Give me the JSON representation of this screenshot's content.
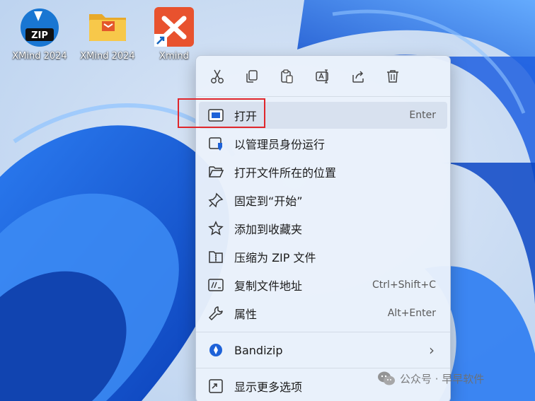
{
  "desktop_icons": [
    {
      "label": "XMind 2024",
      "icon": "zip-archive-icon"
    },
    {
      "label": "XMind 2024",
      "icon": "folder-icon"
    },
    {
      "label": "Xmind",
      "icon": "xmind-shortcut-icon"
    }
  ],
  "context_menu": {
    "toolbar": [
      {
        "name": "cut",
        "icon": "scissors-icon"
      },
      {
        "name": "copy",
        "icon": "copy-icon"
      },
      {
        "name": "paste",
        "icon": "paste-icon"
      },
      {
        "name": "rename",
        "icon": "rename-icon"
      },
      {
        "name": "share",
        "icon": "share-icon"
      },
      {
        "name": "delete",
        "icon": "trash-icon"
      }
    ],
    "items": [
      {
        "label": "打开",
        "shortcut": "Enter",
        "icon": "open-window-icon"
      },
      {
        "label": "以管理员身份运行",
        "shortcut": "",
        "icon": "admin-shield-icon"
      },
      {
        "label": "打开文件所在的位置",
        "shortcut": "",
        "icon": "folder-open-icon"
      },
      {
        "label": "固定到“开始”",
        "shortcut": "",
        "icon": "pin-icon"
      },
      {
        "label": "添加到收藏夹",
        "shortcut": "",
        "icon": "star-icon"
      },
      {
        "label": "压缩为 ZIP 文件",
        "shortcut": "",
        "icon": "zip-folder-icon"
      },
      {
        "label": "复制文件地址",
        "shortcut": "Ctrl+Shift+C",
        "icon": "copy-path-icon"
      },
      {
        "label": "属性",
        "shortcut": "Alt+Enter",
        "icon": "wrench-icon"
      }
    ],
    "bandizip": {
      "label": "Bandizip",
      "icon": "bandizip-icon",
      "submenu_arrow": "›"
    },
    "more": {
      "label": "显示更多选项",
      "icon": "more-options-icon"
    }
  },
  "watermark": {
    "text": "公众号 · 早早软件"
  },
  "colors": {
    "highlight": "#e0262b",
    "menu_bg": "#eaf1fb",
    "accent_blue": "#1e62d8"
  }
}
